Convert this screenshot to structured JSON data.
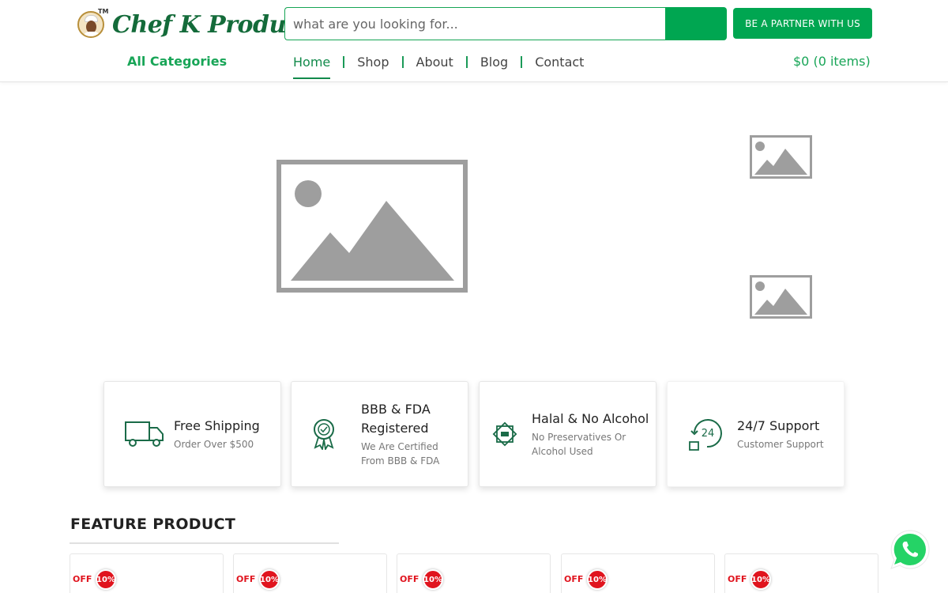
{
  "header": {
    "brand": "Chef K Product",
    "brand_tm": "TM",
    "search": {
      "placeholder": "what are you looking for..."
    },
    "partner_button": "BE A PARTNER WITH US",
    "all_categories": "All Categories",
    "nav": [
      {
        "label": "Home",
        "active": true
      },
      {
        "label": "Shop",
        "active": false
      },
      {
        "label": "About",
        "active": false
      },
      {
        "label": "Blog",
        "active": false
      },
      {
        "label": "Contact",
        "active": false
      }
    ],
    "cart": "$0 (0 items)"
  },
  "features": [
    {
      "icon": "delivery-truck-icon",
      "title": "Free Shipping",
      "subtitle": "Order Over $500"
    },
    {
      "icon": "certified-ribbon-icon",
      "title": "BBB & FDA Registered",
      "subtitle": "We Are Certified From BBB & FDA"
    },
    {
      "icon": "halal-badge-icon",
      "title": "Halal & No Alcohol",
      "subtitle": "No Preservatives Or Alcohol Used"
    },
    {
      "icon": "support-24-icon",
      "title": "24/7 Support",
      "subtitle": "Customer Support"
    }
  ],
  "feature_section": {
    "title": "FEATURE PRODUCT"
  },
  "products": [
    {
      "off_label": "OFF",
      "discount": "10%"
    },
    {
      "off_label": "OFF",
      "discount": "10%"
    },
    {
      "off_label": "OFF",
      "discount": "10%"
    },
    {
      "off_label": "OFF",
      "discount": "10%"
    },
    {
      "off_label": "OFF",
      "discount": "10%"
    }
  ],
  "colors": {
    "brand_green": "#00a651",
    "logo_green": "#146b3a",
    "discount_red": "#e0141e",
    "placeholder_gray": "#9e9e9e"
  }
}
